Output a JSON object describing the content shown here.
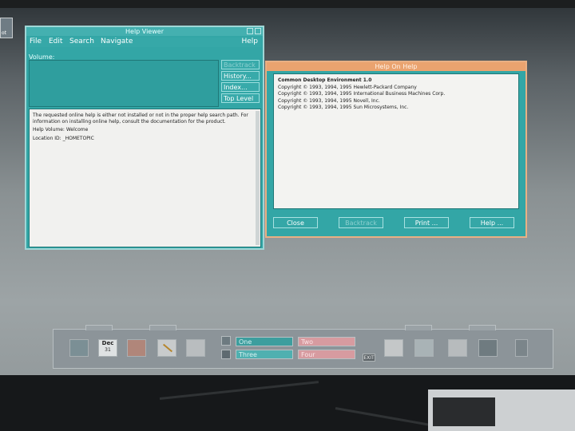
{
  "desktop_icon_label": "ot",
  "help_viewer": {
    "title": "Help Viewer",
    "menu": [
      "File",
      "Edit",
      "Search",
      "Navigate"
    ],
    "help_menu": "Help",
    "volume_label": "Volume:",
    "buttons": [
      "Backtrack",
      "History...",
      "Index...",
      "Top Level"
    ],
    "message": "The requested online help is either not installed or not in the proper help search path.  For information on installing online help, consult the documentation for the product.",
    "help_volume": "Help Volume: Welcome",
    "location_id": "Location ID:  _HOMETOPIC"
  },
  "help_on_help": {
    "title": "Help On Help",
    "heading": "Common Desktop Environment 1.0",
    "lines": [
      "Copyright © 1993, 1994, 1995 Hewlett-Packard Company",
      "Copyright © 1993, 1994, 1995 International Business Machines Corp.",
      "Copyright © 1993, 1994, 1995 Novell, Inc.",
      "Copyright © 1993, 1994, 1995 Sun Microsystems, Inc."
    ],
    "buttons": {
      "close": "Close",
      "backtrack": "Backtrack",
      "print": "Print ...",
      "help": "Help ..."
    }
  },
  "front_panel": {
    "calendar_month": "Dec",
    "calendar_day": "31",
    "workspaces": [
      "One",
      "Two",
      "Three",
      "Four"
    ],
    "exit_label": "EXIT"
  },
  "colors": {
    "window_teal": "#33a6a6",
    "help_on_help_border": "#e9b084",
    "workspace_pink": "#d79ba0"
  }
}
